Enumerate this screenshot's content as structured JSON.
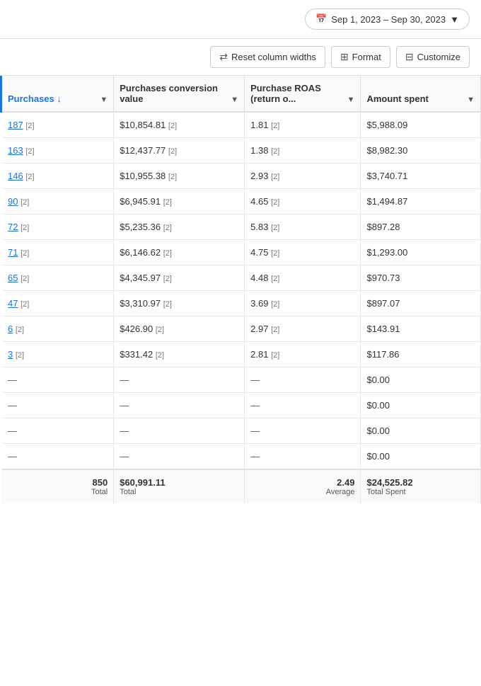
{
  "header": {
    "date_range": "Sep 1, 2023 – Sep 30, 2023"
  },
  "toolbar": {
    "reset_label": "Reset column widths",
    "format_label": "Format",
    "customize_label": "Customize"
  },
  "table": {
    "columns": [
      {
        "id": "purchases",
        "label": "Purchases",
        "sort": "↓",
        "has_dropdown": true
      },
      {
        "id": "conv_value",
        "label": "Purchases conversion value",
        "has_dropdown": true
      },
      {
        "id": "roas",
        "label": "Purchase ROAS (return o...",
        "has_dropdown": true
      },
      {
        "id": "amount_spent",
        "label": "Amount spent",
        "has_dropdown": true
      }
    ],
    "rows": [
      {
        "purchases": "187",
        "purchases_badge": "[2]",
        "conv_value": "$10,854.81",
        "conv_badge": "[2]",
        "roas": "1.81",
        "roas_badge": "[2]",
        "amount": "$5,988.09"
      },
      {
        "purchases": "163",
        "purchases_badge": "[2]",
        "conv_value": "$12,437.77",
        "conv_badge": "[2]",
        "roas": "1.38",
        "roas_badge": "[2]",
        "amount": "$8,982.30"
      },
      {
        "purchases": "146",
        "purchases_badge": "[2]",
        "conv_value": "$10,955.38",
        "conv_badge": "[2]",
        "roas": "2.93",
        "roas_badge": "[2]",
        "amount": "$3,740.71"
      },
      {
        "purchases": "90",
        "purchases_badge": "[2]",
        "conv_value": "$6,945.91",
        "conv_badge": "[2]",
        "roas": "4.65",
        "roas_badge": "[2]",
        "amount": "$1,494.87"
      },
      {
        "purchases": "72",
        "purchases_badge": "[2]",
        "conv_value": "$5,235.36",
        "conv_badge": "[2]",
        "roas": "5.83",
        "roas_badge": "[2]",
        "amount": "$897.28"
      },
      {
        "purchases": "71",
        "purchases_badge": "[2]",
        "conv_value": "$6,146.62",
        "conv_badge": "[2]",
        "roas": "4.75",
        "roas_badge": "[2]",
        "amount": "$1,293.00"
      },
      {
        "purchases": "65",
        "purchases_badge": "[2]",
        "conv_value": "$4,345.97",
        "conv_badge": "[2]",
        "roas": "4.48",
        "roas_badge": "[2]",
        "amount": "$970.73"
      },
      {
        "purchases": "47",
        "purchases_badge": "[2]",
        "conv_value": "$3,310.97",
        "conv_badge": "[2]",
        "roas": "3.69",
        "roas_badge": "[2]",
        "amount": "$897.07"
      },
      {
        "purchases": "6",
        "purchases_badge": "[2]",
        "conv_value": "$426.90",
        "conv_badge": "[2]",
        "roas": "2.97",
        "roas_badge": "[2]",
        "amount": "$143.91"
      },
      {
        "purchases": "3",
        "purchases_badge": "[2]",
        "conv_value": "$331.42",
        "conv_badge": "[2]",
        "roas": "2.81",
        "roas_badge": "[2]",
        "amount": "$117.86"
      },
      {
        "purchases": "—",
        "purchases_badge": "",
        "conv_value": "—",
        "conv_badge": "",
        "roas": "—",
        "roas_badge": "",
        "amount": "$0.00"
      },
      {
        "purchases": "—",
        "purchases_badge": "",
        "conv_value": "—",
        "conv_badge": "",
        "roas": "—",
        "roas_badge": "",
        "amount": "$0.00"
      },
      {
        "purchases": "—",
        "purchases_badge": "",
        "conv_value": "—",
        "conv_badge": "",
        "roas": "—",
        "roas_badge": "",
        "amount": "$0.00"
      },
      {
        "purchases": "—",
        "purchases_badge": "",
        "conv_value": "—",
        "conv_badge": "",
        "roas": "—",
        "roas_badge": "",
        "amount": "$0.00"
      }
    ],
    "footer": {
      "purchases_total": "850",
      "purchases_label": "Total",
      "conv_total": "$60,991.11",
      "conv_label": "Total",
      "roas_total": "2.49",
      "roas_label": "Average",
      "amount_total": "$24,525.82",
      "amount_label": "Total Spent"
    }
  }
}
